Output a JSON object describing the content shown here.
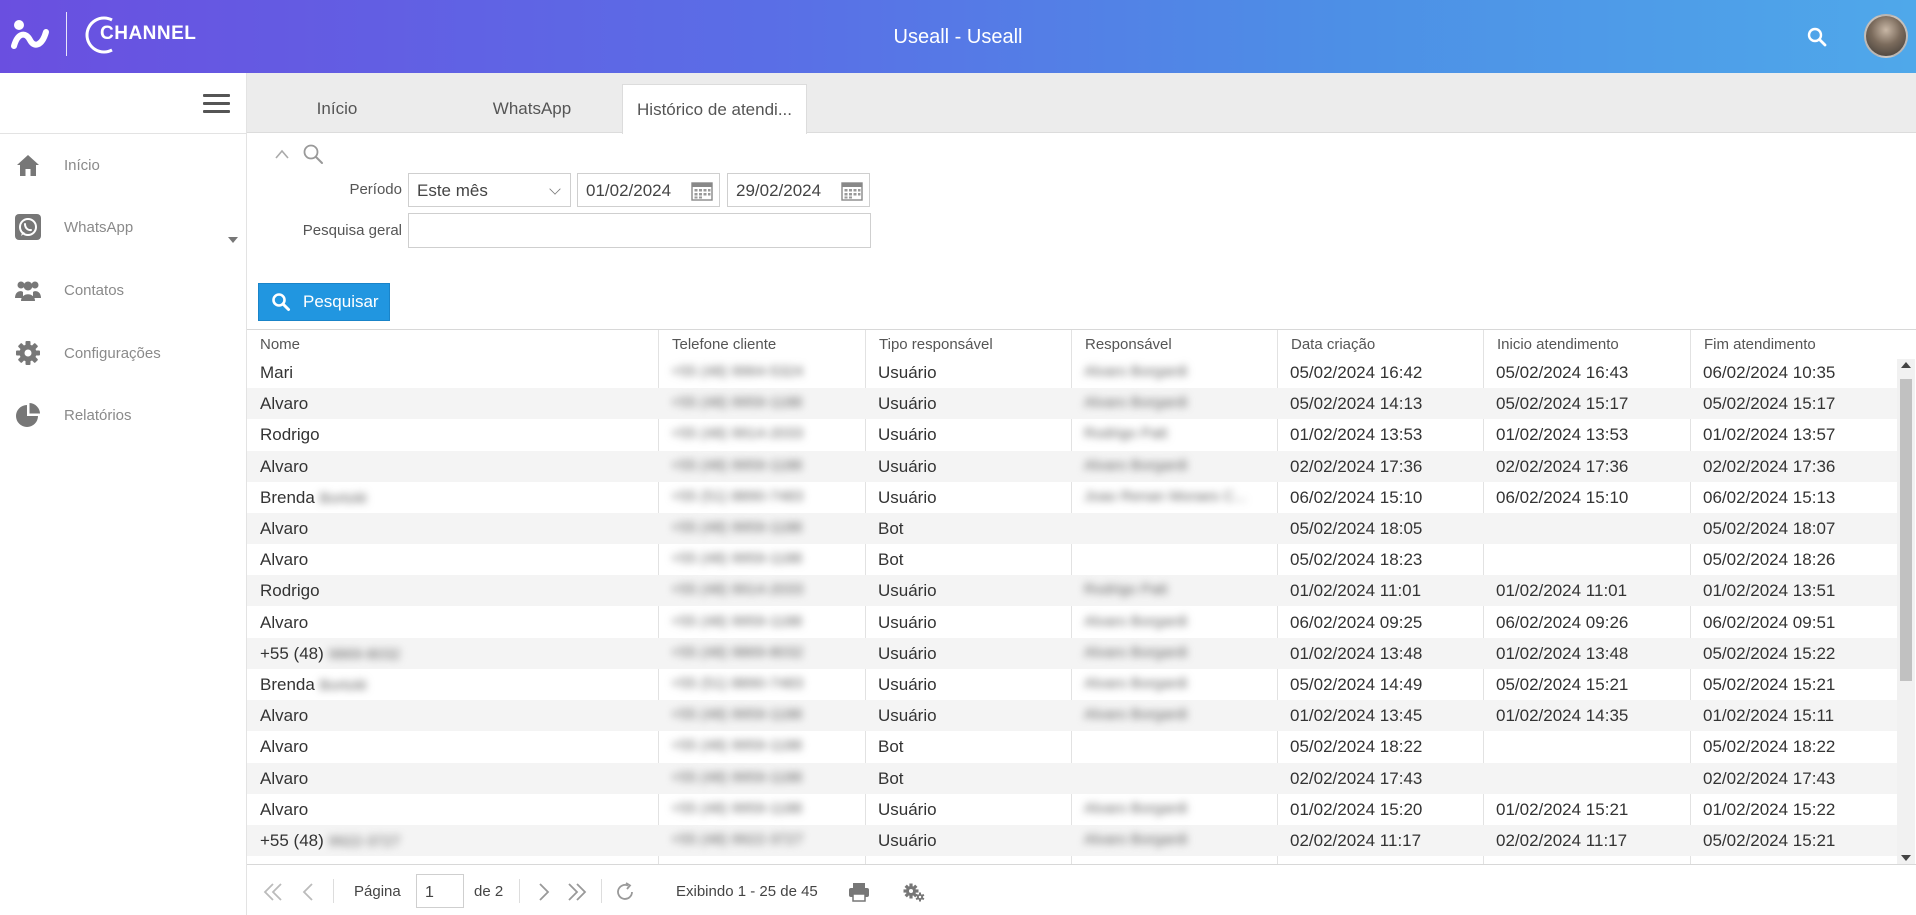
{
  "app": {
    "title": "Useall - Useall",
    "logo_text": "CHANNEL"
  },
  "header": {
    "search_icon": "search-icon"
  },
  "sidebar": {
    "items": [
      {
        "label": "Início",
        "icon": "home-icon"
      },
      {
        "label": "WhatsApp",
        "icon": "whatsapp-icon"
      },
      {
        "label": "Contatos",
        "icon": "users-icon"
      },
      {
        "label": "Configurações",
        "icon": "gear-icon"
      },
      {
        "label": "Relatórios",
        "icon": "pie-chart-icon"
      }
    ]
  },
  "tabs": [
    {
      "label": "Início",
      "active": false
    },
    {
      "label": "WhatsApp",
      "active": false
    },
    {
      "label": "Histórico de atendi...",
      "active": true
    }
  ],
  "filters": {
    "periodo_label": "Período",
    "periodo_value": "Este mês",
    "date_from": "01/02/2024",
    "date_to": "29/02/2024",
    "pesquisa_label": "Pesquisa geral",
    "pesquisa_value": "",
    "search_button": "Pesquisar"
  },
  "grid": {
    "columns": [
      "Nome",
      "Telefone cliente",
      "Tipo responsável",
      "Responsável",
      "Data criação",
      "Inicio atendimento",
      "Fim atendimento"
    ],
    "rows": [
      [
        "Mari",
        "+55 (48) 9964-5324",
        "Usuário",
        "Alvaro Borgardi",
        "05/02/2024 16:42",
        "05/02/2024 16:43",
        "06/02/2024 10:35"
      ],
      [
        "Alvaro",
        "+55 (48) 9959-1188",
        "Usuário",
        "Alvaro Borgardi",
        "05/02/2024 14:13",
        "05/02/2024 15:17",
        "05/02/2024 15:17"
      ],
      [
        "Rodrigo",
        "+55 (48) 9914-2033",
        "Usuário",
        "Rodrigo Patt",
        "01/02/2024 13:53",
        "01/02/2024 13:53",
        "01/02/2024 13:57"
      ],
      [
        "Alvaro",
        "+55 (48) 9959-1188",
        "Usuário",
        "Alvaro Borgardi",
        "02/02/2024 17:36",
        "02/02/2024 17:36",
        "02/02/2024 17:36"
      ],
      [
        "Brenda Bortolé",
        "+55 (51) 8890-7483",
        "Usuário",
        "Joao Renan Moraes C...",
        "06/02/2024 15:10",
        "06/02/2024 15:10",
        "06/02/2024 15:13"
      ],
      [
        "Alvaro",
        "+55 (48) 9959-1188",
        "Bot",
        "",
        "05/02/2024 18:05",
        "",
        "05/02/2024 18:07"
      ],
      [
        "Alvaro",
        "+55 (48) 9959-1188",
        "Bot",
        "",
        "05/02/2024 18:23",
        "",
        "05/02/2024 18:26"
      ],
      [
        "Rodrigo",
        "+55 (48) 9914-2033",
        "Usuário",
        "Rodrigo Patt",
        "01/02/2024 11:01",
        "01/02/2024 11:01",
        "01/02/2024 13:51"
      ],
      [
        "Alvaro",
        "+55 (48) 9959-1188",
        "Usuário",
        "Alvaro Borgardi",
        "06/02/2024 09:25",
        "06/02/2024 09:26",
        "06/02/2024 09:51"
      ],
      [
        "+55 (48) 9869-8032",
        "+55 (48) 9869-8032",
        "Usuário",
        "Alvaro Borgardi",
        "01/02/2024 13:48",
        "01/02/2024 13:48",
        "05/02/2024 15:22"
      ],
      [
        "Brenda Bortolé",
        "+55 (51) 8890-7483",
        "Usuário",
        "Alvaro Borgardi",
        "05/02/2024 14:49",
        "05/02/2024 15:21",
        "05/02/2024 15:21"
      ],
      [
        "Alvaro",
        "+55 (48) 9959-1188",
        "Usuário",
        "Alvaro Borgardi",
        "01/02/2024 13:45",
        "01/02/2024 14:35",
        "01/02/2024 15:11"
      ],
      [
        "Alvaro",
        "+55 (48) 9959-1188",
        "Bot",
        "",
        "05/02/2024 18:22",
        "",
        "05/02/2024 18:22"
      ],
      [
        "Alvaro",
        "+55 (48) 9959-1188",
        "Bot",
        "",
        "02/02/2024 17:43",
        "",
        "02/02/2024 17:43"
      ],
      [
        "Alvaro",
        "+55 (48) 9959-1188",
        "Usuário",
        "Alvaro Borgardi",
        "01/02/2024 15:20",
        "01/02/2024 15:21",
        "01/02/2024 15:22"
      ],
      [
        "+55 (48) 9922-3727",
        "+55 (48) 9922-3727",
        "Usuário",
        "Alvaro Borgardi",
        "02/02/2024 11:17",
        "02/02/2024 11:17",
        "05/02/2024 15:21"
      ]
    ]
  },
  "pager": {
    "page_label": "Página",
    "page_value": "1",
    "of_label": "de 2",
    "summary": "Exibindo 1 - 25 de 45"
  }
}
